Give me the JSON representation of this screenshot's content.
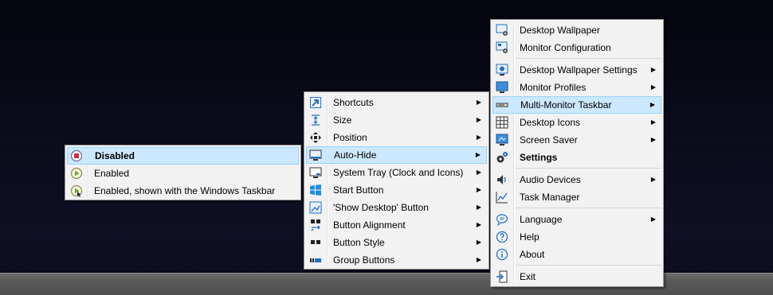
{
  "main_menu": {
    "items": [
      {
        "label": "Desktop Wallpaper",
        "icon": "wallpaper-gear-icon",
        "submenu": false
      },
      {
        "label": "Monitor Configuration",
        "icon": "monitor-config-icon",
        "submenu": false
      },
      {
        "label": "Desktop Wallpaper Settings",
        "icon": "wallpaper-settings-icon",
        "submenu": true
      },
      {
        "label": "Monitor Profiles",
        "icon": "monitor-icon",
        "submenu": true
      },
      {
        "label": "Multi-Monitor Taskbar",
        "icon": "taskbar-icon",
        "submenu": true,
        "highlighted": true
      },
      {
        "label": "Desktop Icons",
        "icon": "grid-icon",
        "submenu": true
      },
      {
        "label": "Screen Saver",
        "icon": "screensaver-icon",
        "submenu": true
      },
      {
        "label": "Settings",
        "icon": "gears-icon",
        "submenu": false,
        "bold": true
      },
      {
        "label": "Audio Devices",
        "icon": "speaker-icon",
        "submenu": true
      },
      {
        "label": "Task Manager",
        "icon": "chart-icon",
        "submenu": false
      },
      {
        "label": "Language",
        "icon": "speech-bubble-icon",
        "submenu": true
      },
      {
        "label": "Help",
        "icon": "help-icon",
        "submenu": false
      },
      {
        "label": "About",
        "icon": "info-icon",
        "submenu": false
      },
      {
        "label": "Exit",
        "icon": "exit-door-icon",
        "submenu": false
      }
    ]
  },
  "taskbar_menu": {
    "items": [
      {
        "label": "Shortcuts",
        "icon": "shortcut-arrow-icon",
        "submenu": true
      },
      {
        "label": "Size",
        "icon": "resize-icon",
        "submenu": true
      },
      {
        "label": "Position",
        "icon": "move-arrows-icon",
        "submenu": true
      },
      {
        "label": "Auto-Hide",
        "icon": "auto-hide-icon",
        "submenu": true,
        "highlighted": true
      },
      {
        "label": "System Tray (Clock and Icons)",
        "icon": "system-tray-icon",
        "submenu": true
      },
      {
        "label": "Start Button",
        "icon": "windows-logo-icon",
        "submenu": true
      },
      {
        "label": "'Show Desktop' Button",
        "icon": "show-desktop-icon",
        "submenu": true
      },
      {
        "label": "Button Alignment",
        "icon": "alignment-icon",
        "submenu": true
      },
      {
        "label": "Button Style",
        "icon": "button-style-icon",
        "submenu": true
      },
      {
        "label": "Group Buttons",
        "icon": "group-buttons-icon",
        "submenu": true
      }
    ]
  },
  "autohide_menu": {
    "items": [
      {
        "label": "Disabled",
        "icon": "stop-icon",
        "selected": true,
        "bold": true
      },
      {
        "label": "Enabled",
        "icon": "play-icon",
        "selected": false
      },
      {
        "label": "Enabled, shown with the Windows Taskbar",
        "icon": "play-taskbar-icon",
        "selected": false
      }
    ]
  },
  "submenu_arrow": "▶",
  "colors": {
    "highlight": "#cce8ff",
    "highlight_border": "#99d1ff",
    "menu_bg": "#f2f2f2",
    "icon_blue": "#1e6fc8"
  }
}
